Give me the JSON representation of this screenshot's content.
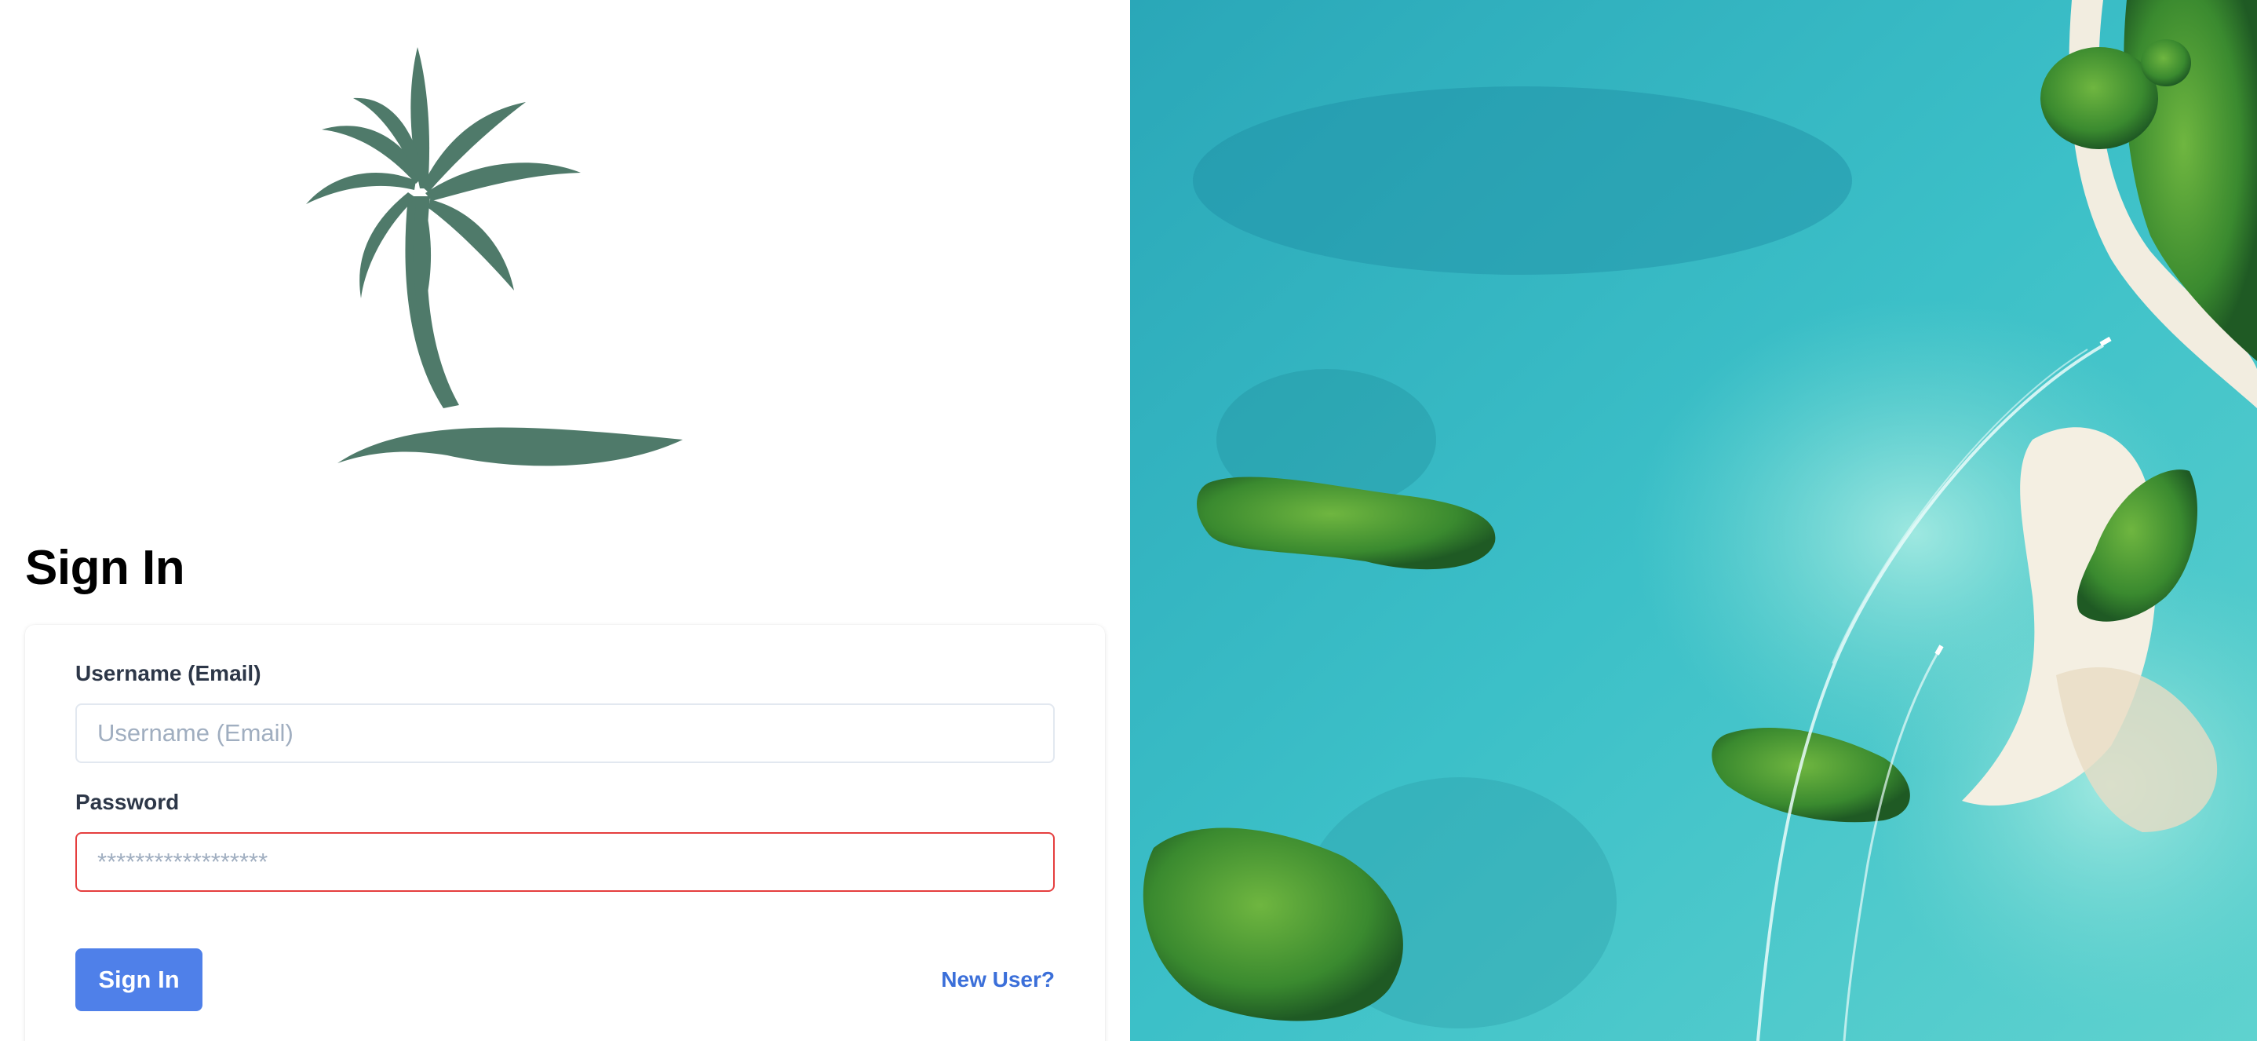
{
  "branding": {
    "logo_icon": "palm-tree-icon",
    "logo_color": "#4f7a6a"
  },
  "signin": {
    "title": "Sign In",
    "username_label": "Username (Email)",
    "username_placeholder": "Username (Email)",
    "username_value": "",
    "password_label": "Password",
    "password_placeholder": "******************",
    "password_value": "",
    "submit_label": "Sign In",
    "new_user_label": "New User?"
  },
  "colors": {
    "primary_button": "#4f80e9",
    "link": "#3b6fd9",
    "error_border": "#e53e3e",
    "water": "#3cc0c8",
    "sand": "#f2ede0",
    "foliage": "#3f8f32"
  },
  "hero_image": {
    "subject": "aerial-islands-photo"
  }
}
